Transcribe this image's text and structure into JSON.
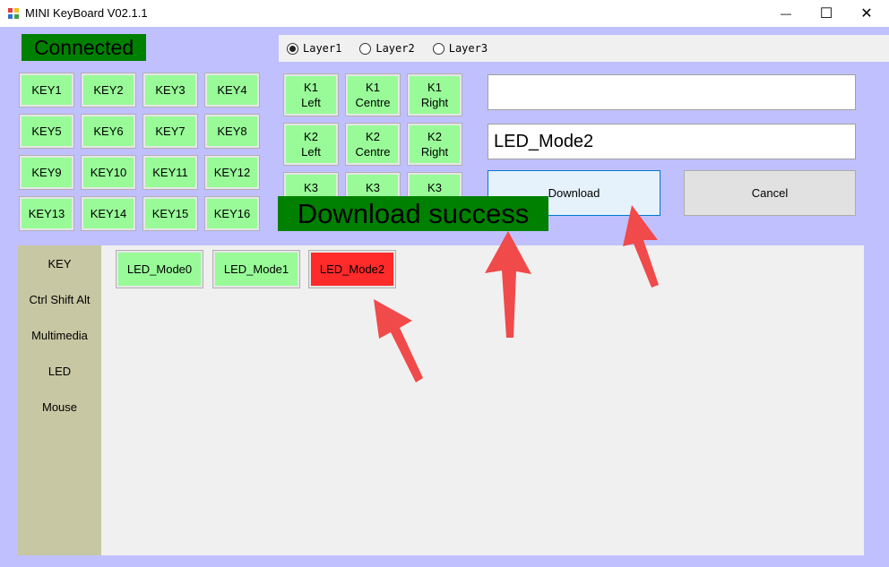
{
  "window": {
    "title": "MINI KeyBoard V02.1.1",
    "minimize_glyph": "—",
    "maximize_glyph": "☐",
    "close_glyph": "✕"
  },
  "status": {
    "connected": "Connected",
    "download_success": "Download success"
  },
  "layers": [
    {
      "label": "Layer1",
      "checked": true
    },
    {
      "label": "Layer2",
      "checked": false
    },
    {
      "label": "Layer3",
      "checked": false
    }
  ],
  "keys": [
    "KEY1",
    "KEY2",
    "KEY3",
    "KEY4",
    "KEY5",
    "KEY6",
    "KEY7",
    "KEY8",
    "KEY9",
    "KEY10",
    "KEY11",
    "KEY12",
    "KEY13",
    "KEY14",
    "KEY15",
    "KEY16"
  ],
  "knobs": [
    {
      "line1": "K1",
      "line2": "Left"
    },
    {
      "line1": "K1",
      "line2": "Centre"
    },
    {
      "line1": "K1",
      "line2": "Right"
    },
    {
      "line1": "K2",
      "line2": "Left"
    },
    {
      "line1": "K2",
      "line2": "Centre"
    },
    {
      "line1": "K2",
      "line2": "Right"
    },
    {
      "line1": "K3",
      "line2": ""
    },
    {
      "line1": "K3",
      "line2": ""
    },
    {
      "line1": "K3",
      "line2": ""
    }
  ],
  "inputs": {
    "input_1_value": "",
    "input_2_value": "LED_Mode2"
  },
  "actions": {
    "download_label": "Download",
    "cancel_label": "Cancel"
  },
  "nav": [
    "KEY",
    "Ctrl Shift Alt",
    "Multimedia",
    "LED",
    "Mouse"
  ],
  "led_modes": [
    {
      "label": "LED_Mode0",
      "selected": false
    },
    {
      "label": "LED_Mode1",
      "selected": false
    },
    {
      "label": "LED_Mode2",
      "selected": true
    }
  ],
  "colors": {
    "background": "#c0c0ff",
    "status_green": "#008000",
    "button_green": "#98fb98",
    "selected_red": "#ff2a2a",
    "nav_background": "#c7c7a3",
    "arrow_red": "#f04a4a"
  },
  "icons": {
    "app": "keyboard-app-icon",
    "annotation": "red-arrow-annotation"
  }
}
